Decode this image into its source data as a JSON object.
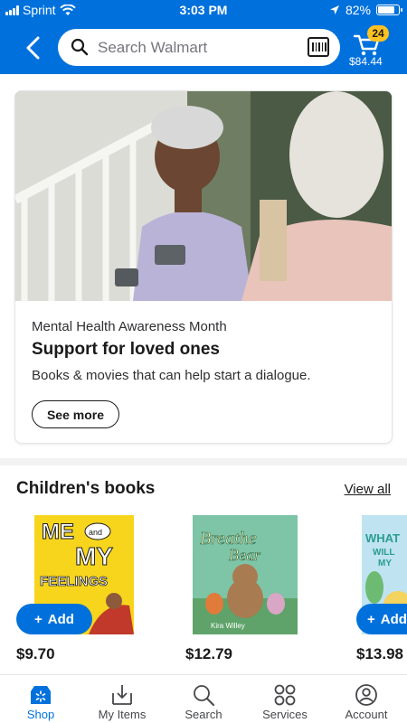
{
  "status_bar": {
    "carrier": "Sprint",
    "time": "3:03 PM",
    "battery": "82%"
  },
  "header": {
    "search_placeholder": "Search Walmart",
    "cart_count": "24",
    "cart_total": "$84.44"
  },
  "promo": {
    "eyebrow": "Mental Health Awareness Month",
    "title": "Support for loved ones",
    "description": "Books & movies that can help start a dialogue.",
    "button": "See more"
  },
  "section": {
    "title": "Children's books",
    "view_all": "View all",
    "products": [
      {
        "cover_title": "ME and MY FEELINGS",
        "price": "$9.70",
        "add_label": "Add"
      },
      {
        "cover_title": "Breathe Like a Bear",
        "cover_author": "Kira Willey",
        "price": "$12.79"
      },
      {
        "cover_title": "WHAT WILL MY",
        "price": "$13.98",
        "add_label": "Add"
      }
    ]
  },
  "bottom_nav": [
    {
      "label": "Shop",
      "icon": "shop-icon",
      "active": true
    },
    {
      "label": "My Items",
      "icon": "my-items-icon",
      "active": false
    },
    {
      "label": "Search",
      "icon": "search-icon",
      "active": false
    },
    {
      "label": "Services",
      "icon": "services-icon",
      "active": false
    },
    {
      "label": "Account",
      "icon": "account-icon",
      "active": false
    }
  ],
  "colors": {
    "brand_blue": "#0071dc",
    "badge_yellow": "#ffc220"
  }
}
